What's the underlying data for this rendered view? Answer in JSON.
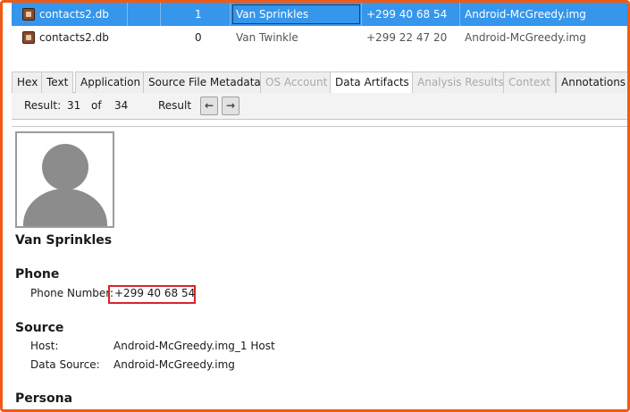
{
  "results_table": {
    "rows": [
      {
        "file": "contacts2.db",
        "num": "1",
        "person": "Van Sprinkles",
        "phone": "+299 40 68 54",
        "source": "Android-McGreedy.img"
      },
      {
        "file": "contacts2.db",
        "num": "0",
        "person": "Van Twinkle",
        "phone": "+299 22 47 20",
        "source": "Android-McGreedy.img"
      }
    ]
  },
  "tabs": [
    "Hex",
    "Text",
    "Application",
    "Source File Metadata",
    "OS Account",
    "Data Artifacts",
    "Analysis Results",
    "Context",
    "Annotations"
  ],
  "toolbar": {
    "result_label": "Result:",
    "current": "31",
    "of_label": "of",
    "total": "34",
    "result_nav_label": "Result",
    "prev_glyph": "←",
    "next_glyph": "→"
  },
  "contact": {
    "name": "Van Sprinkles",
    "phone_section": "Phone",
    "phone_label": "Phone Number:",
    "phone_value": "+299 40 68 54",
    "source_section": "Source",
    "host_label": "Host:",
    "host_value": "Android-McGreedy.img_1 Host",
    "datasource_label": "Data Source:",
    "datasource_value": "Android-McGreedy.img",
    "persona_section": "Persona"
  },
  "colors": {
    "frame_border": "#f05a14",
    "selection": "#3596ec",
    "highlight_box": "#d8232a"
  }
}
